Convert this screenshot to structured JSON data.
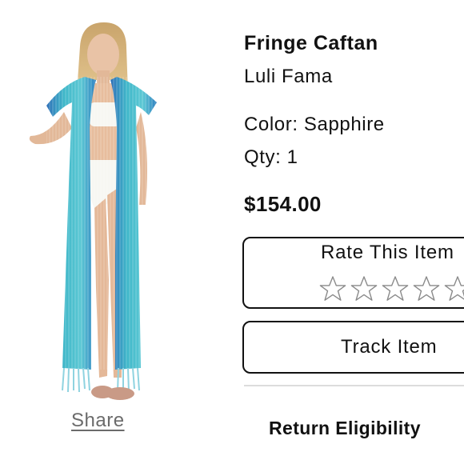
{
  "product": {
    "image_alt": "Fringe Caftan product photo",
    "title": "Fringe Caftan",
    "brand": "Luli Fama",
    "color_line": "Color: Sapphire",
    "qty_line": "Qty: 1",
    "price": "$154.00"
  },
  "share_label": "Share",
  "rating": {
    "label": "Rate This Item",
    "stars_max": 5,
    "stars_selected": 0,
    "star_icon": "star-outline-icon"
  },
  "track_label": "Track Item",
  "return_heading": "Return Eligibility",
  "colors": {
    "caftan_turquoise": "#3fb7c9",
    "caftan_blue": "#2f6fb8",
    "border": "#111111",
    "star_outline": "#8a8a8a",
    "share_text": "#6b6b6b",
    "divider": "#dcdcdc"
  }
}
